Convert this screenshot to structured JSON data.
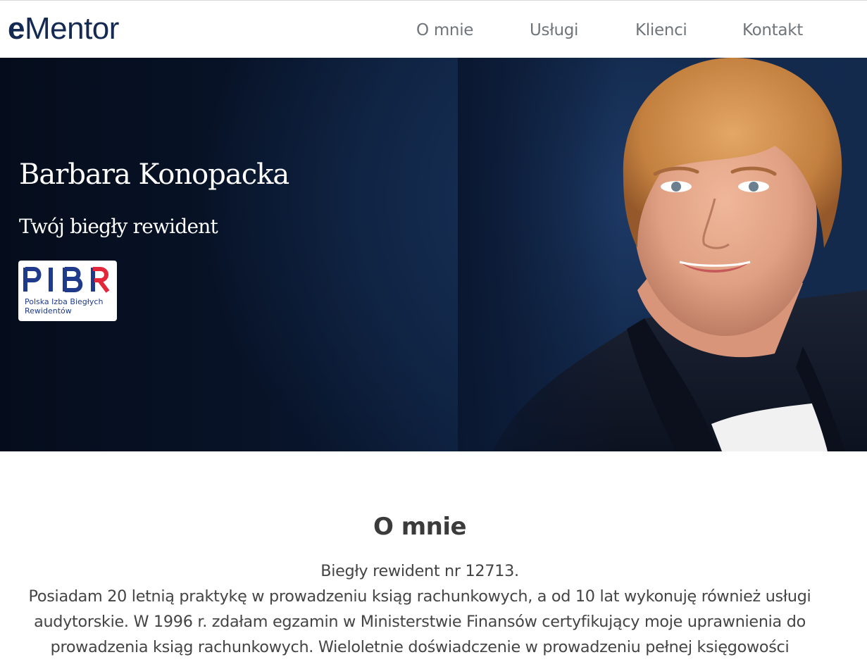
{
  "header": {
    "logo": {
      "prefix": "e",
      "rest": "Mentor"
    },
    "nav": [
      {
        "label": "O mnie"
      },
      {
        "label": "Usługi"
      },
      {
        "label": "Klienci"
      },
      {
        "label": "Kontakt"
      }
    ]
  },
  "hero": {
    "name": "Barbara Konopacka",
    "subtitle": "Twój biegły rewident",
    "badge": {
      "logo_text": "PIBR",
      "line1": "Polska Izba Biegłych",
      "line2": "Rewidentów"
    }
  },
  "about": {
    "title": "O mnie",
    "lines": [
      "Biegły rewident nr 12713.",
      "Posiadam 20 letnią praktykę w prowadzeniu ksiąg rachunkowych, a od 10 lat wykonuję również usługi",
      "audytorskie. W 1996 r. zdałam egzamin w Ministerstwie Finansów certyfikujący moje uprawnienia do",
      "prowadzenia ksiąg rachunkowych. Wieloletnie doświadczenie w prowadzeniu pełnej księgowości"
    ]
  },
  "colors": {
    "logo": "#152a52",
    "nav": "#6f7579",
    "hero_bg": "#0b1a33",
    "badge_blue": "#1f3a8a",
    "badge_red": "#e3263a",
    "heading": "#3b3b3b",
    "body_text": "#444444"
  },
  "icons": {
    "badge": "pibr-logo"
  }
}
